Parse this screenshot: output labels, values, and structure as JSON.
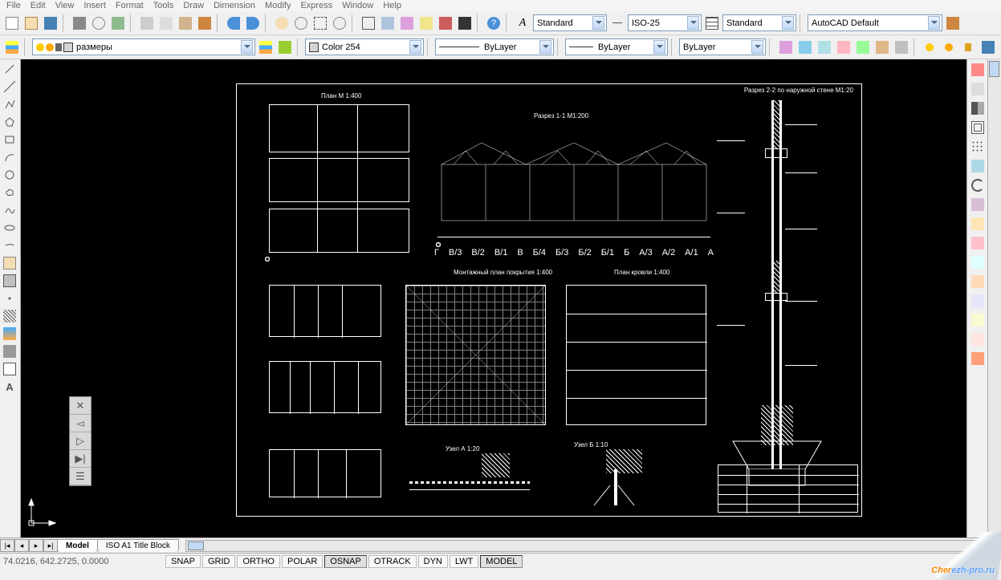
{
  "menu": [
    "File",
    "Edit",
    "View",
    "Insert",
    "Format",
    "Tools",
    "Draw",
    "Dimension",
    "Modify",
    "Express",
    "Window",
    "Help"
  ],
  "toolbar1": {
    "text_style": "Standard",
    "dim_style": "ISO-25",
    "table_style": "Standard",
    "plot_style": "AutoCAD Default"
  },
  "toolbar2": {
    "layer": "размеры",
    "color": "Color 254",
    "color_hex": "#d4d4d4",
    "linetype": "ByLayer",
    "lineweight": "ByLayer",
    "plotstyle": "ByLayer"
  },
  "tabs": {
    "active": "Model",
    "other": "ISO A1 Title Block"
  },
  "status": {
    "coords": "74.0216, 642.2725, 0.0000",
    "toggles": [
      "SNAP",
      "GRID",
      "ORTHO",
      "POLAR",
      "OSNAP",
      "OTRACK",
      "DYN",
      "LWT",
      "MODEL"
    ]
  },
  "drawing": {
    "plan_label": "План М 1:400",
    "section1_label": "Разрез 1-1 М1:200",
    "section2_label": "Разрез 2-2 по наружной стене М1:20",
    "montage_label": "Монтажный план покрытия 1:400",
    "roof_label": "План кровли 1:400",
    "node_a_label": "Узел А 1:20",
    "node_b_label": "Узел Б 1:10",
    "axes": [
      "Г",
      "В/3",
      "В/2",
      "В/1",
      "В",
      "Б/4",
      "Б/3",
      "Б/2",
      "Б/1",
      "Б",
      "А/3",
      "А/2",
      "А/1",
      "А"
    ]
  },
  "watermark": {
    "text1": "Cher",
    "text2": "ezh-pro.ru"
  }
}
